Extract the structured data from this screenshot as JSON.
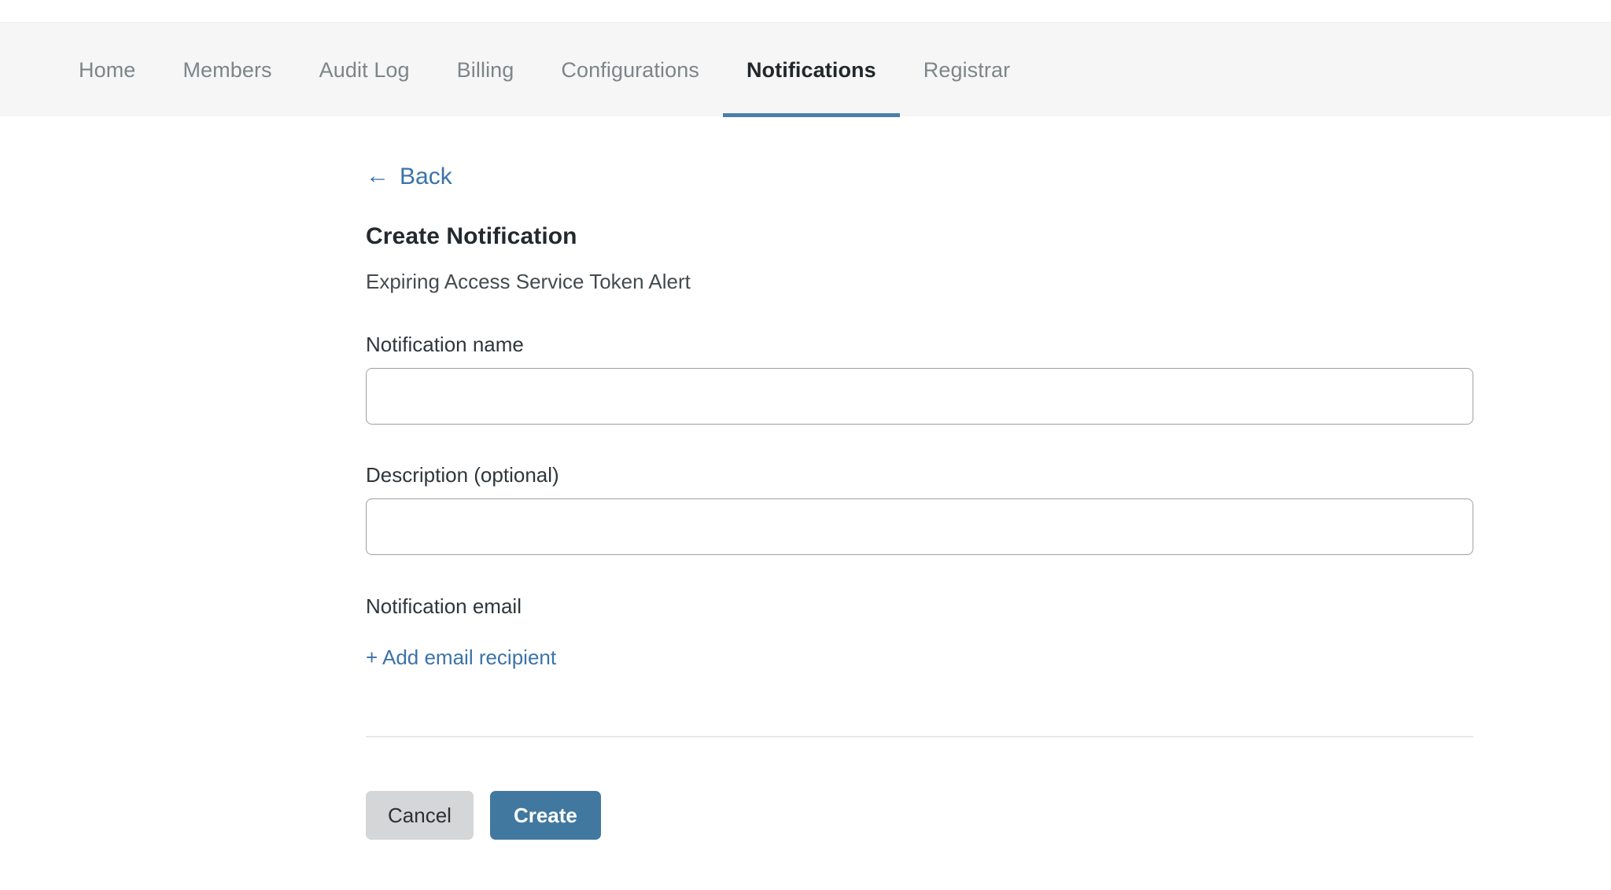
{
  "nav": {
    "tabs": [
      {
        "label": "Home",
        "active": false
      },
      {
        "label": "Members",
        "active": false
      },
      {
        "label": "Audit Log",
        "active": false
      },
      {
        "label": "Billing",
        "active": false
      },
      {
        "label": "Configurations",
        "active": false
      },
      {
        "label": "Notifications",
        "active": true
      },
      {
        "label": "Registrar",
        "active": false
      }
    ]
  },
  "back": {
    "arrow": "←",
    "label": "Back"
  },
  "page": {
    "title": "Create Notification",
    "subtitle": "Expiring Access Service Token Alert"
  },
  "form": {
    "name_field": {
      "label": "Notification name",
      "value": "",
      "placeholder": ""
    },
    "description_field": {
      "label": "Description (optional)",
      "value": "",
      "placeholder": ""
    },
    "email_section": {
      "label": "Notification email",
      "add_link": "+ Add email recipient"
    }
  },
  "actions": {
    "cancel_label": "Cancel",
    "create_label": "Create"
  },
  "colors": {
    "accent_blue": "#41789f",
    "link_blue": "#3b73a8",
    "tab_underline": "#4a7fa8",
    "tabbar_bg": "#f6f6f6",
    "cancel_bg": "#d5d6d7",
    "input_border": "#9aa1a6",
    "divider": "#e6e8ea"
  }
}
